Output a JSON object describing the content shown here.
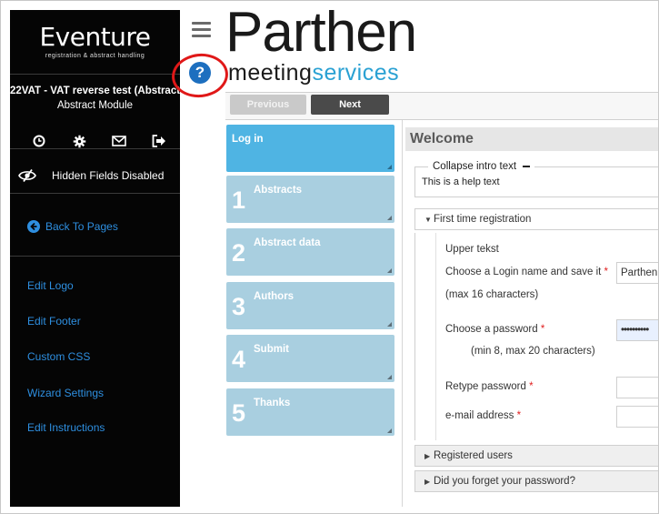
{
  "sidebar": {
    "brand_name": "Eventure",
    "brand_tagline": "registration & abstract handling",
    "event_title": "22VAT - VAT reverse test (Abstract...",
    "event_subtitle": "Abstract Module",
    "toolbar_icons": [
      "clock-icon",
      "gear-icon",
      "envelope-icon",
      "sign-out-icon"
    ],
    "hidden_fields_label": "Hidden Fields Disabled",
    "back_label": "Back To Pages",
    "links": [
      "Edit Logo",
      "Edit Footer",
      "Custom CSS",
      "Wizard Settings",
      "Edit Instructions"
    ]
  },
  "logo": {
    "main": "Parthen",
    "sub_dark": "meeting",
    "sub_accent": "services",
    "accent_color": "#2aa1d3"
  },
  "nav": {
    "previous_label": "Previous",
    "next_label": "Next"
  },
  "steps": [
    {
      "num": "",
      "label": "Log in",
      "active": true
    },
    {
      "num": "1",
      "label": "Abstracts",
      "active": false
    },
    {
      "num": "2",
      "label": "Abstract data",
      "active": false
    },
    {
      "num": "3",
      "label": "Authors",
      "active": false
    },
    {
      "num": "4",
      "label": "Submit",
      "active": false
    },
    {
      "num": "5",
      "label": "Thanks",
      "active": false
    }
  ],
  "main": {
    "welcome_title": "Welcome",
    "intro": {
      "legend": "Collapse intro text",
      "text": "This is a help text"
    },
    "first_time": {
      "title": "First time registration",
      "upper_text": "Upper tekst",
      "login_label": "Choose a Login name and save it",
      "login_hint": "(max 16 characters)",
      "login_value": "Parthen",
      "password_label": "Choose a password",
      "password_hint": "(min 8, max 20 characters)",
      "password_value": "••••••••••",
      "retype_label": "Retype password",
      "retype_value": "",
      "email_label": "e-mail address",
      "email_value": "",
      "required_mark": "*"
    },
    "registered_users": "Registered users",
    "forgot_password": "Did you forget your password?"
  },
  "colors": {
    "sidebar_bg": "#050505",
    "link": "#2e8fe0",
    "step_active": "#4fb4e3",
    "step_inactive": "#a9cfe0",
    "help_icon": "#1d6fbf",
    "highlight_ring": "#e01818"
  }
}
